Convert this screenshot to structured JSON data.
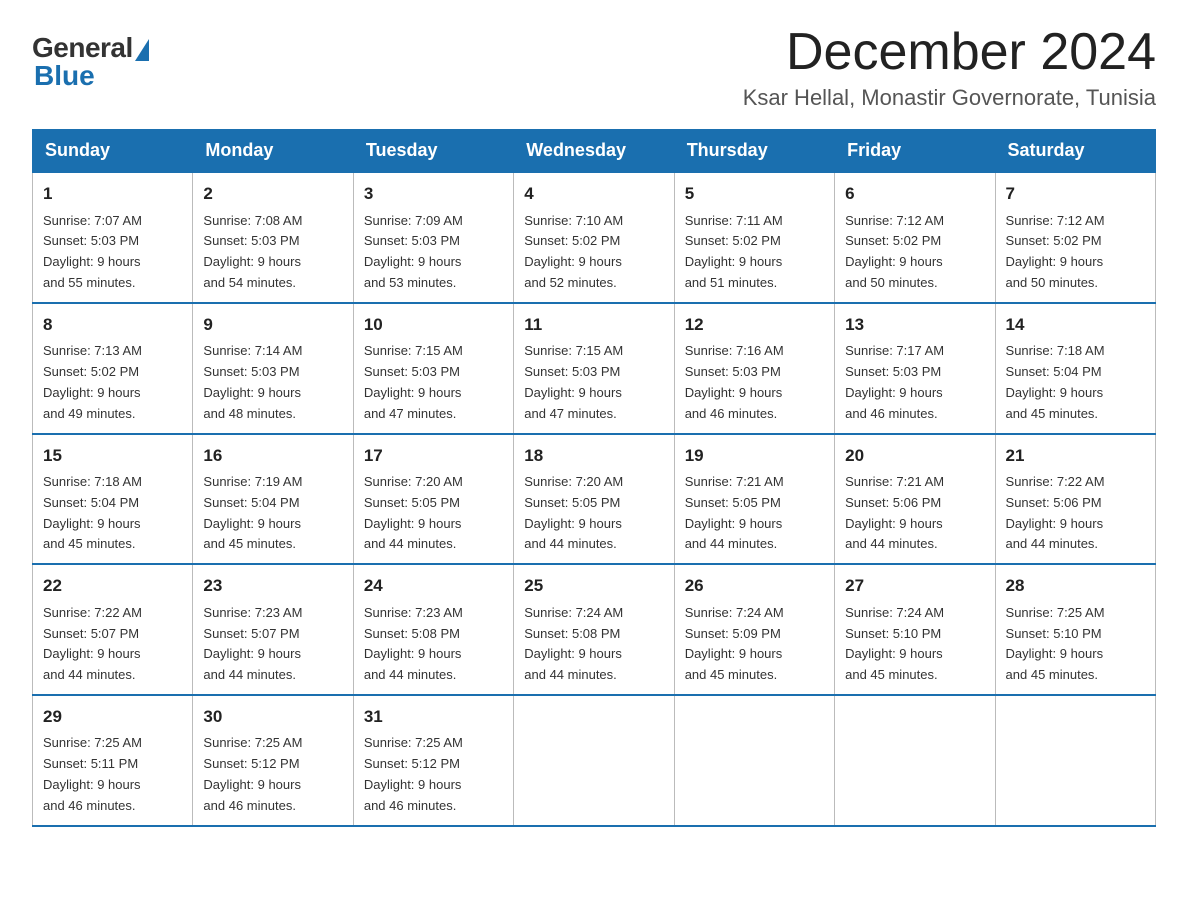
{
  "logo": {
    "general": "General",
    "blue": "Blue"
  },
  "header": {
    "month": "December 2024",
    "location": "Ksar Hellal, Monastir Governorate, Tunisia"
  },
  "days_of_week": [
    "Sunday",
    "Monday",
    "Tuesday",
    "Wednesday",
    "Thursday",
    "Friday",
    "Saturday"
  ],
  "weeks": [
    [
      {
        "day": "1",
        "sunrise": "7:07 AM",
        "sunset": "5:03 PM",
        "daylight": "9 hours and 55 minutes."
      },
      {
        "day": "2",
        "sunrise": "7:08 AM",
        "sunset": "5:03 PM",
        "daylight": "9 hours and 54 minutes."
      },
      {
        "day": "3",
        "sunrise": "7:09 AM",
        "sunset": "5:03 PM",
        "daylight": "9 hours and 53 minutes."
      },
      {
        "day": "4",
        "sunrise": "7:10 AM",
        "sunset": "5:02 PM",
        "daylight": "9 hours and 52 minutes."
      },
      {
        "day": "5",
        "sunrise": "7:11 AM",
        "sunset": "5:02 PM",
        "daylight": "9 hours and 51 minutes."
      },
      {
        "day": "6",
        "sunrise": "7:12 AM",
        "sunset": "5:02 PM",
        "daylight": "9 hours and 50 minutes."
      },
      {
        "day": "7",
        "sunrise": "7:12 AM",
        "sunset": "5:02 PM",
        "daylight": "9 hours and 50 minutes."
      }
    ],
    [
      {
        "day": "8",
        "sunrise": "7:13 AM",
        "sunset": "5:02 PM",
        "daylight": "9 hours and 49 minutes."
      },
      {
        "day": "9",
        "sunrise": "7:14 AM",
        "sunset": "5:03 PM",
        "daylight": "9 hours and 48 minutes."
      },
      {
        "day": "10",
        "sunrise": "7:15 AM",
        "sunset": "5:03 PM",
        "daylight": "9 hours and 47 minutes."
      },
      {
        "day": "11",
        "sunrise": "7:15 AM",
        "sunset": "5:03 PM",
        "daylight": "9 hours and 47 minutes."
      },
      {
        "day": "12",
        "sunrise": "7:16 AM",
        "sunset": "5:03 PM",
        "daylight": "9 hours and 46 minutes."
      },
      {
        "day": "13",
        "sunrise": "7:17 AM",
        "sunset": "5:03 PM",
        "daylight": "9 hours and 46 minutes."
      },
      {
        "day": "14",
        "sunrise": "7:18 AM",
        "sunset": "5:04 PM",
        "daylight": "9 hours and 45 minutes."
      }
    ],
    [
      {
        "day": "15",
        "sunrise": "7:18 AM",
        "sunset": "5:04 PM",
        "daylight": "9 hours and 45 minutes."
      },
      {
        "day": "16",
        "sunrise": "7:19 AM",
        "sunset": "5:04 PM",
        "daylight": "9 hours and 45 minutes."
      },
      {
        "day": "17",
        "sunrise": "7:20 AM",
        "sunset": "5:05 PM",
        "daylight": "9 hours and 44 minutes."
      },
      {
        "day": "18",
        "sunrise": "7:20 AM",
        "sunset": "5:05 PM",
        "daylight": "9 hours and 44 minutes."
      },
      {
        "day": "19",
        "sunrise": "7:21 AM",
        "sunset": "5:05 PM",
        "daylight": "9 hours and 44 minutes."
      },
      {
        "day": "20",
        "sunrise": "7:21 AM",
        "sunset": "5:06 PM",
        "daylight": "9 hours and 44 minutes."
      },
      {
        "day": "21",
        "sunrise": "7:22 AM",
        "sunset": "5:06 PM",
        "daylight": "9 hours and 44 minutes."
      }
    ],
    [
      {
        "day": "22",
        "sunrise": "7:22 AM",
        "sunset": "5:07 PM",
        "daylight": "9 hours and 44 minutes."
      },
      {
        "day": "23",
        "sunrise": "7:23 AM",
        "sunset": "5:07 PM",
        "daylight": "9 hours and 44 minutes."
      },
      {
        "day": "24",
        "sunrise": "7:23 AM",
        "sunset": "5:08 PM",
        "daylight": "9 hours and 44 minutes."
      },
      {
        "day": "25",
        "sunrise": "7:24 AM",
        "sunset": "5:08 PM",
        "daylight": "9 hours and 44 minutes."
      },
      {
        "day": "26",
        "sunrise": "7:24 AM",
        "sunset": "5:09 PM",
        "daylight": "9 hours and 45 minutes."
      },
      {
        "day": "27",
        "sunrise": "7:24 AM",
        "sunset": "5:10 PM",
        "daylight": "9 hours and 45 minutes."
      },
      {
        "day": "28",
        "sunrise": "7:25 AM",
        "sunset": "5:10 PM",
        "daylight": "9 hours and 45 minutes."
      }
    ],
    [
      {
        "day": "29",
        "sunrise": "7:25 AM",
        "sunset": "5:11 PM",
        "daylight": "9 hours and 46 minutes."
      },
      {
        "day": "30",
        "sunrise": "7:25 AM",
        "sunset": "5:12 PM",
        "daylight": "9 hours and 46 minutes."
      },
      {
        "day": "31",
        "sunrise": "7:25 AM",
        "sunset": "5:12 PM",
        "daylight": "9 hours and 46 minutes."
      },
      null,
      null,
      null,
      null
    ]
  ],
  "labels": {
    "sunrise": "Sunrise:",
    "sunset": "Sunset:",
    "daylight": "Daylight:"
  }
}
